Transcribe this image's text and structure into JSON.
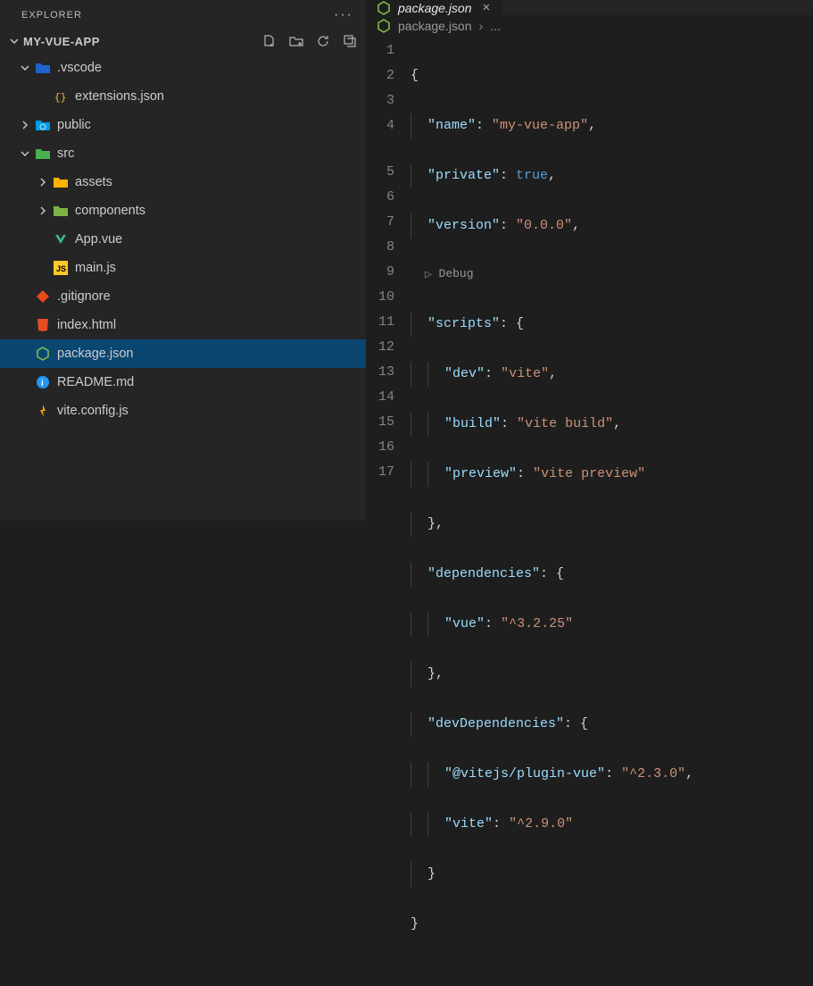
{
  "explorer": {
    "title": "EXPLORER"
  },
  "project": {
    "name": "MY-VUE-APP"
  },
  "tree": {
    "vscode": ".vscode",
    "extensions": "extensions.json",
    "public": "public",
    "src": "src",
    "assets": "assets",
    "components": "components",
    "appvue": "App.vue",
    "mainjs": "main.js",
    "gitignore": ".gitignore",
    "indexhtml": "index.html",
    "packagejson": "package.json",
    "readme": "README.md",
    "viteconfig": "vite.config.js"
  },
  "tab": {
    "label": "package.json"
  },
  "breadcrumb": {
    "file": "package.json",
    "more": "..."
  },
  "codelens": {
    "debug": "Debug"
  },
  "lines": [
    "1",
    "2",
    "3",
    "4",
    "5",
    "6",
    "7",
    "8",
    "9",
    "10",
    "11",
    "12",
    "13",
    "14",
    "15",
    "16",
    "17"
  ],
  "json": {
    "name_key": "\"name\"",
    "name_val": "\"my-vue-app\"",
    "private_key": "\"private\"",
    "private_val": "true",
    "version_key": "\"version\"",
    "version_val": "\"0.0.0\"",
    "scripts_key": "\"scripts\"",
    "dev_key": "\"dev\"",
    "dev_val": "\"vite\"",
    "build_key": "\"build\"",
    "build_val": "\"vite build\"",
    "preview_key": "\"preview\"",
    "preview_val": "\"vite preview\"",
    "deps_key": "\"dependencies\"",
    "vue_key": "\"vue\"",
    "vue_val": "\"^3.2.25\"",
    "devdeps_key": "\"devDependencies\"",
    "plugin_key": "\"@vitejs/plugin-vue\"",
    "plugin_val": "\"^2.3.0\"",
    "vite_key": "\"vite\"",
    "vite_val": "\"^2.9.0\""
  }
}
